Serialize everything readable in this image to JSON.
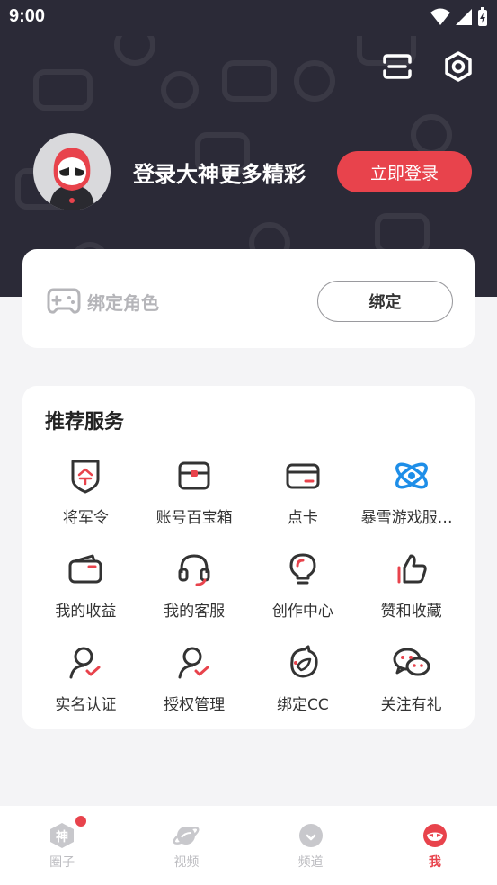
{
  "status_bar": {
    "time": "9:00"
  },
  "header": {
    "login_prompt": "登录大神更多精彩",
    "login_button": "立即登录"
  },
  "bind_card": {
    "label": "绑定角色",
    "button": "绑定"
  },
  "services": {
    "title": "推荐服务",
    "items": [
      {
        "label": "将军令",
        "icon": "shield-token-icon"
      },
      {
        "label": "账号百宝箱",
        "icon": "treasure-box-icon"
      },
      {
        "label": "点卡",
        "icon": "card-icon"
      },
      {
        "label": "暴雪游戏服务中心",
        "icon": "blizzard-logo-icon"
      },
      {
        "label": "我的收益",
        "icon": "wallet-icon"
      },
      {
        "label": "我的客服",
        "icon": "headset-icon"
      },
      {
        "label": "创作中心",
        "icon": "lightbulb-icon"
      },
      {
        "label": "赞和收藏",
        "icon": "thumbs-up-icon"
      },
      {
        "label": "实名认证",
        "icon": "user-verified-icon"
      },
      {
        "label": "授权管理",
        "icon": "user-auth-icon"
      },
      {
        "label": "绑定CC",
        "icon": "cc-logo-icon"
      },
      {
        "label": "关注有礼",
        "icon": "wechat-icon"
      }
    ]
  },
  "tabbar": {
    "tabs": [
      {
        "label": "圈子",
        "icon": "shen-icon",
        "badge": true
      },
      {
        "label": "视频",
        "icon": "planet-icon"
      },
      {
        "label": "频道",
        "icon": "channel-icon"
      },
      {
        "label": "我",
        "icon": "me-icon",
        "active": true
      }
    ]
  },
  "colors": {
    "accent": "#e8434c",
    "header_bg": "#2b2a37",
    "page_bg": "#f4f4f6"
  }
}
